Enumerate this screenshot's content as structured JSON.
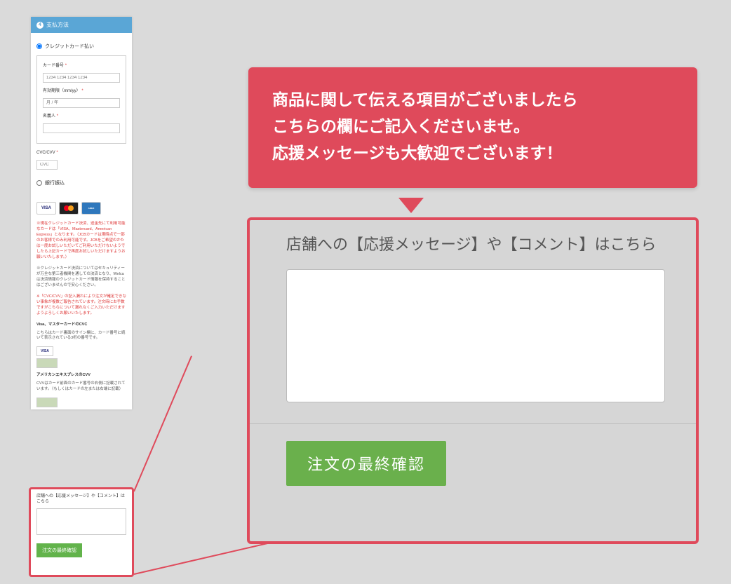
{
  "header": {
    "step_number": "4",
    "title": "支払方法"
  },
  "payment": {
    "radio_cc_label": "クレジットカード払い",
    "radio_bank_label": "銀行振込",
    "card_number_label": "カード番号",
    "card_number_placeholder": "1234 1234 1234 1234",
    "expiry_label": "有効期限（mm/yy）",
    "expiry_placeholder": "月 / 年",
    "name_label": "名義人",
    "cvc_label": "CVC/CVV",
    "cvc_placeholder": "CVC",
    "required_mark": "*"
  },
  "cards": {
    "visa": "VISA",
    "mc_alt": "mastercard",
    "amex": "AMEX"
  },
  "notices": {
    "red1": "※現在クレジットカード決済、送金先にて利用可能なカードは「VISA、Mastercard、American Express」となります。（JCBカードは現時点で一部のお客様でのみ利用可能です。JCBをご希望のかたは一度お試しいただいてご利用いただけないようでしたら上記カードで再度お試しいただけますようお願いいたします。）",
    "black1": "※クレジットカード決済についてはセキュリティーが万全な第三者機関を通しての決済となり、Welcaは決済情報のクレジットカード情報を保持することはございませんので安心ください。",
    "red2": "※「CVC/CVV」の記入漏れにより注文が確定できない事象が複数ご報告されています。注文時にお手数ですがこちらについて漏れなくご入力いただけますようよろしくお願いいたします。",
    "visa_mc_head": "Visa、マスターカードのCVC",
    "visa_mc_body": "こちらはカード裏面のサイン欄に、カード番号に続いて表示されている3桁の番号です。",
    "amex_head": "アメリカンエキスプレスのCVV",
    "amex_body": "CVVはカード前面のカード番号の右側に記載されています。（もしくはカードの左または右端に記載）"
  },
  "comment_small": {
    "label": "店舗への【応援メッセージ】や【コメント】はこちら",
    "submit": "注文の最終確認"
  },
  "callout": {
    "line1": "商品に関して伝える項目がございましたら",
    "line2": "こちらの欄にご記入くださいませ。",
    "line3": "応援メッセージも大歓迎でございます！"
  },
  "big": {
    "label": "店舗への【応援メッセージ】や【コメント】はこちら",
    "submit": "注文の最終確認"
  }
}
